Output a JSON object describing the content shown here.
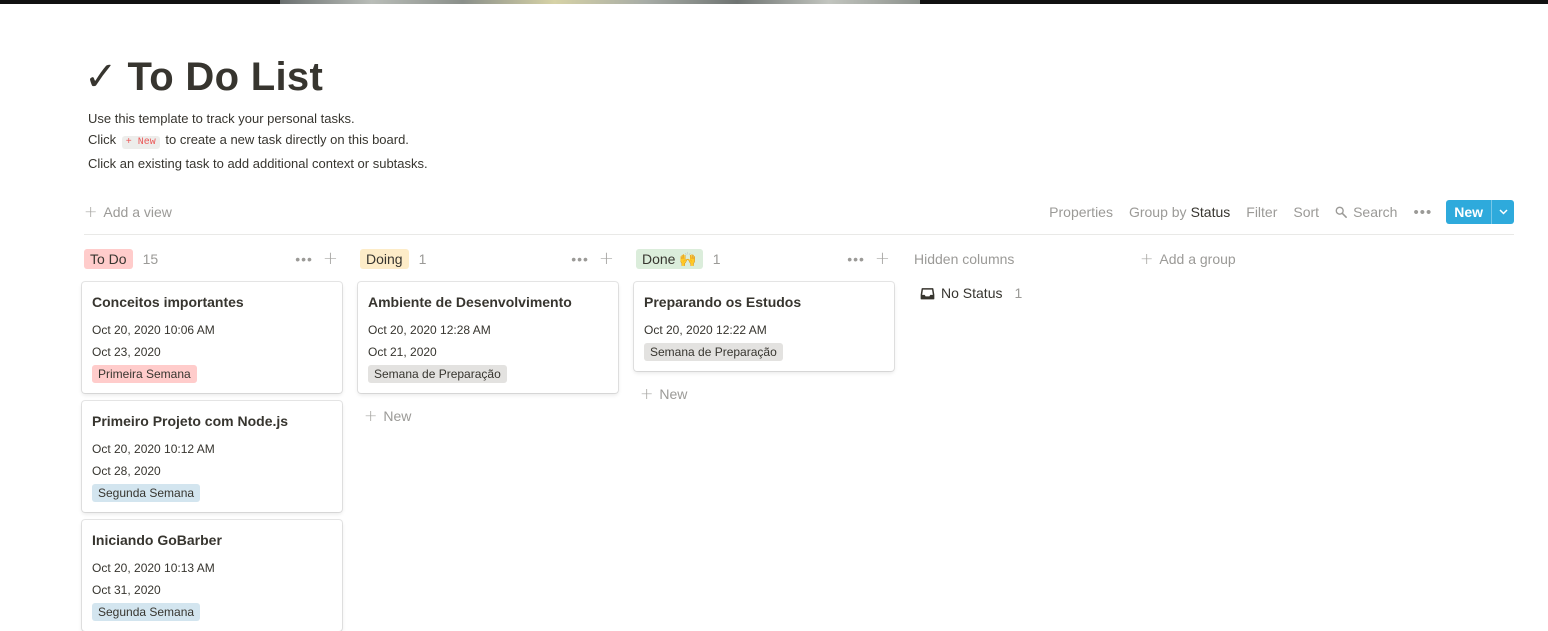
{
  "page": {
    "title_icon": "✓",
    "title": "To Do List",
    "description": {
      "line1": "Use this template to track your personal tasks.",
      "line2_prefix": "Click ",
      "line2_code": "+ New",
      "line2_suffix": " to create a new task directly on this board.",
      "line3": "Click an existing task to add additional context or subtasks."
    }
  },
  "toolbar": {
    "add_view": "Add a view",
    "properties": "Properties",
    "group_by_label": "Group by",
    "group_by_value": "Status",
    "filter": "Filter",
    "sort": "Sort",
    "search": "Search",
    "more": "•••",
    "new_button": "New"
  },
  "columns": [
    {
      "name": "To Do",
      "count": "15",
      "color": "#ffcccb",
      "cards": [
        {
          "title": "Conceitos importantes",
          "created": "Oct 20, 2020 10:06 AM",
          "due": "Oct 23, 2020",
          "tag": "Primeira Semana"
        },
        {
          "title": "Primeiro Projeto com Node.js",
          "created": "Oct 20, 2020 10:12 AM",
          "due": "Oct 28, 2020",
          "tag": "Segunda Semana"
        },
        {
          "title": "Iniciando GoBarber",
          "created": "Oct 20, 2020 10:13 AM",
          "due": "Oct 31, 2020",
          "tag": "Segunda Semana"
        }
      ]
    },
    {
      "name": "Doing",
      "count": "1",
      "color": "#fdecc8",
      "cards": [
        {
          "title": "Ambiente de Desenvolvimento",
          "created": "Oct 20, 2020 12:28 AM",
          "due": "Oct 21, 2020",
          "tag": "Semana de Preparação"
        }
      ],
      "new_label": "New"
    },
    {
      "name": "Done 🙌",
      "count": "1",
      "color": "#dbeddb",
      "cards": [
        {
          "title": "Preparando os Estudos",
          "created": "Oct 20, 2020 12:22 AM",
          "tag": "Semana de Preparação"
        }
      ],
      "new_label": "New"
    }
  ],
  "hidden_columns": {
    "label": "Hidden columns",
    "no_status": "No Status",
    "no_status_count": "1"
  },
  "add_group": "Add a group",
  "colors": {
    "accent_blue": "#2eaadc",
    "tag_red": "#ffcccb",
    "tag_blue": "#d3e5ef",
    "tag_gray": "#e3e2e0",
    "muted_text": "#9b9a97"
  }
}
